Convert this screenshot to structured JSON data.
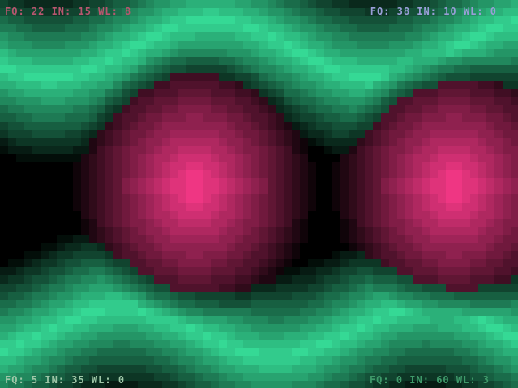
{
  "hud": {
    "top_left": {
      "text": "FQ: 22 IN: 15 WL: 8",
      "color": "#b8566f"
    },
    "top_right": {
      "text": "FQ: 38 IN: 10 WL: 0",
      "color": "#9a9ed8"
    },
    "bottom_left": {
      "text": "FQ: 5 IN: 35 WL: 0",
      "color": "#9fc7a8"
    },
    "bottom_right": {
      "text": "FQ: 0 IN: 60 WL: 3",
      "color": "#3f9a6a"
    }
  },
  "colors": {
    "background": "#000000",
    "green": "#35d995",
    "pink": "#ff3a8c"
  }
}
